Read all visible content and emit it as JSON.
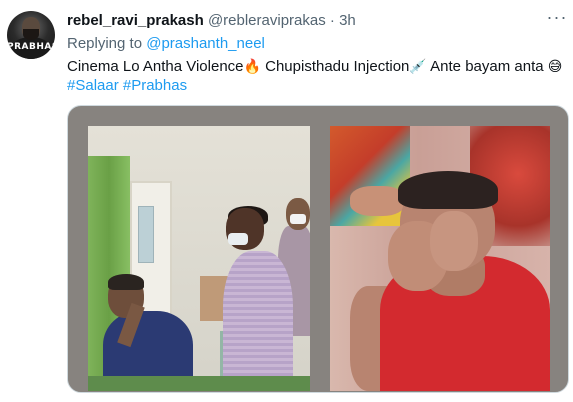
{
  "tweet": {
    "display_name": "rebel_ravi_prakash",
    "handle": "@rebleraviprakas",
    "separator": "·",
    "time": "3h",
    "more_icon": "more-horizontal-icon",
    "more_glyph": "···",
    "avatar_text": "PRABHAS",
    "replying_prefix": "Replying to",
    "replying_to": "@prashanth_neel",
    "text_part1": "Cinema Lo Antha Violence",
    "emoji_fire": "🔥",
    "text_part2": " Chupisthadu Injection",
    "emoji_syringe": "💉",
    "text_part3": " Ante bayam anta ",
    "emoji_sweat": "😅",
    "hashtags": [
      "#Salaar",
      "#Prabhas"
    ]
  },
  "colors": {
    "link": "#1d9bf0",
    "secondary_text": "#536471",
    "primary_text": "#0f1419"
  }
}
